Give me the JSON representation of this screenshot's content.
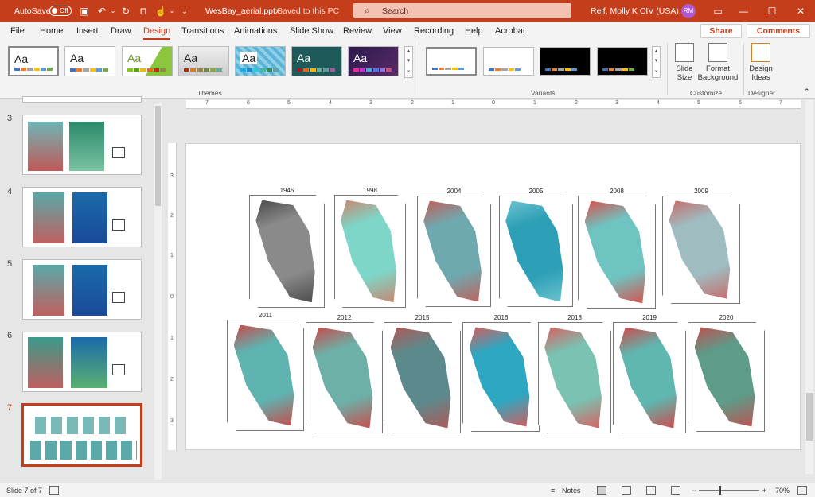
{
  "titlebar": {
    "autosave": "AutoSave",
    "toggle": "Off",
    "filename": "WesBay_aerial.pptx",
    "saved": "Saved to this PC",
    "search": "Search",
    "user": "Reif, Molly K CIV (USA)",
    "initials": "RM"
  },
  "tabs": [
    "File",
    "Home",
    "Insert",
    "Draw",
    "Design",
    "Transitions",
    "Animations",
    "Slide Show",
    "Review",
    "View",
    "Recording",
    "Help",
    "Acrobat"
  ],
  "active_tab": "Design",
  "share": "Share",
  "comments": "Comments",
  "ribbon": {
    "themes_label": "Themes",
    "variants_label": "Variants",
    "customize_label": "Customize",
    "designer_label": "Designer",
    "slide_size": "Slide Size",
    "format_background": "Format Background",
    "design_ideas": "Design Ideas",
    "theme_aa": "Aa"
  },
  "thumbnails": [
    {
      "num": "3"
    },
    {
      "num": "4"
    },
    {
      "num": "5"
    },
    {
      "num": "6"
    },
    {
      "num": "7"
    }
  ],
  "ruler_h": [
    "7",
    "6",
    "5",
    "4",
    "3",
    "2",
    "1",
    "0",
    "1",
    "2",
    "3",
    "4",
    "5",
    "6",
    "7"
  ],
  "ruler_v": [
    "3",
    "2",
    "1",
    "0",
    "1",
    "2",
    "3"
  ],
  "slide_images": [
    {
      "year": "1945",
      "color": "#8a8a8a",
      "color2": "#4a4a4a"
    },
    {
      "year": "1998",
      "color": "#7ed6c8",
      "color2": "#c9866f"
    },
    {
      "year": "2004",
      "color": "#6fa9b0",
      "color2": "#c0605a"
    },
    {
      "year": "2005",
      "color": "#2d9fb6",
      "color2": "#6cc3cf"
    },
    {
      "year": "2008",
      "color": "#6fc4c2",
      "color2": "#d8504a"
    },
    {
      "year": "2009",
      "color": "#9fbcc0",
      "color2": "#c86a6a"
    },
    {
      "year": "2011",
      "color": "#5fb3b0",
      "color2": "#c84a4a"
    },
    {
      "year": "2012",
      "color": "#6db0a8",
      "color2": "#c84a4a"
    },
    {
      "year": "2015",
      "color": "#5c8a8c",
      "color2": "#b05858"
    },
    {
      "year": "2016",
      "color": "#2ea8c2",
      "color2": "#d85a5a"
    },
    {
      "year": "2018",
      "color": "#7ac2b2",
      "color2": "#d86060"
    },
    {
      "year": "2019",
      "color": "#5fb7b0",
      "color2": "#d04848"
    },
    {
      "year": "2020",
      "color": "#5e9b88",
      "color2": "#c05050"
    }
  ],
  "status": {
    "slide": "Slide 7 of 7",
    "notes": "Notes",
    "zoom": "70%"
  }
}
